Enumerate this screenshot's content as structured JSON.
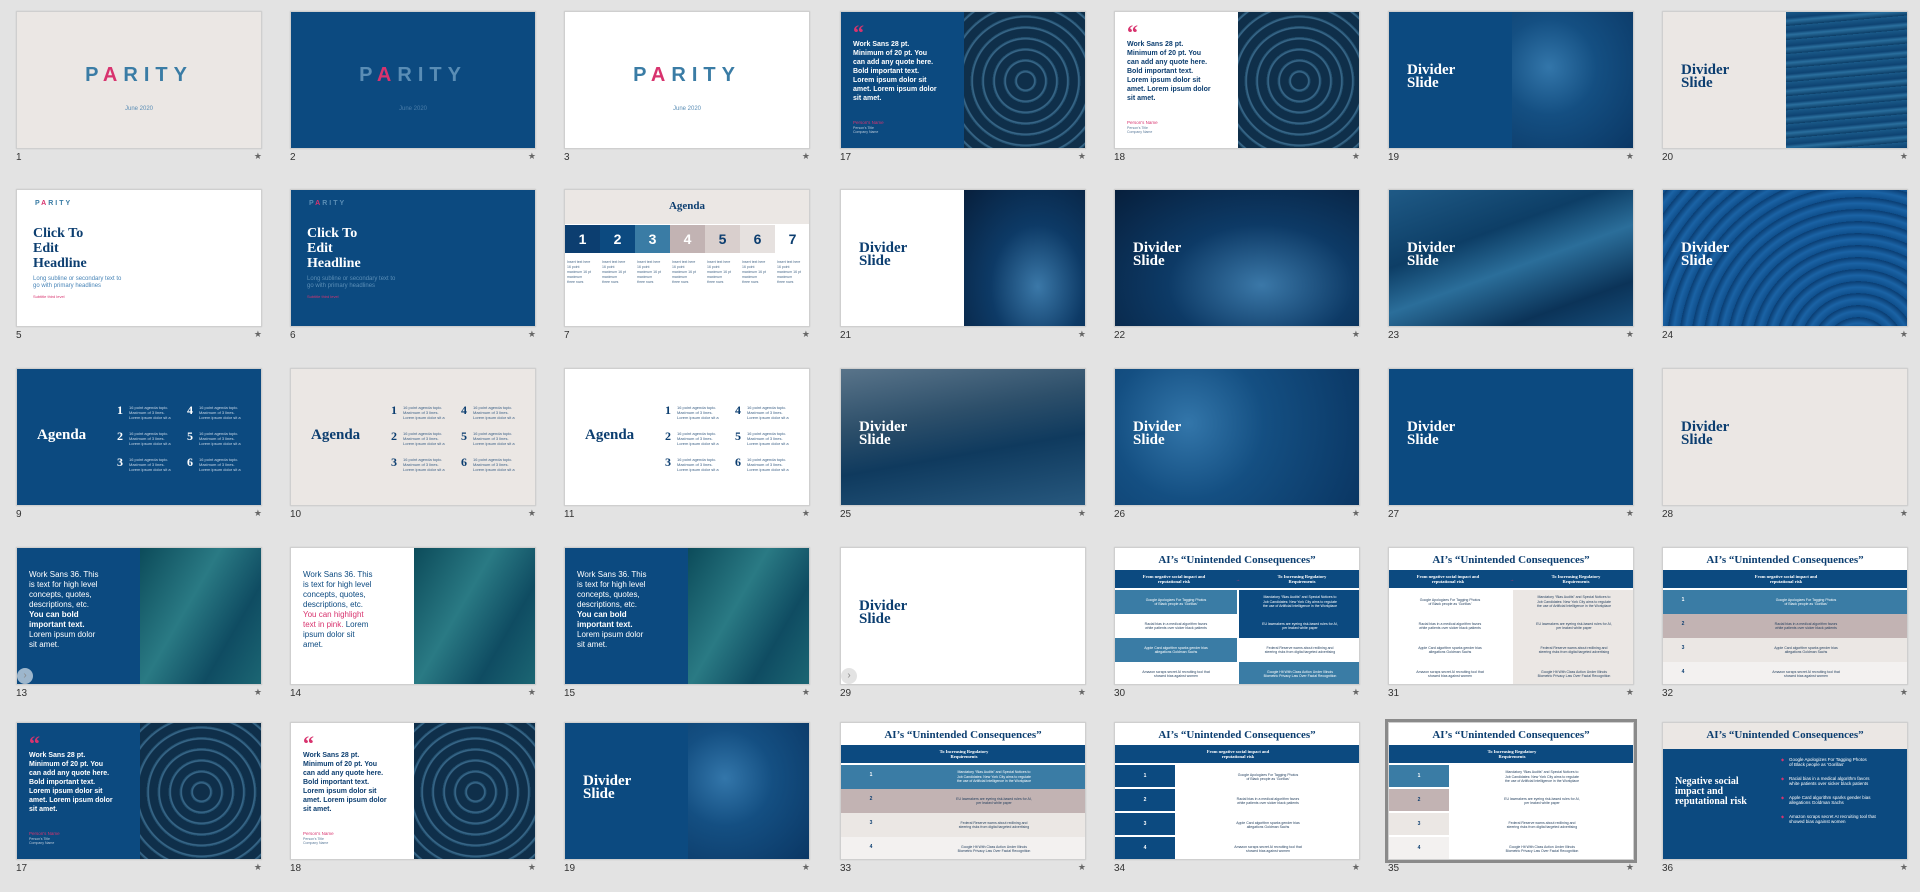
{
  "brand": {
    "logo_left": "P",
    "logo_a": "A",
    "logo_right": "RITY",
    "date": "June 2020",
    "colors": {
      "navy": "#0c4a80",
      "pink": "#d8336e",
      "teal": "#3a7ca5",
      "cream": "#ebe7e4"
    }
  },
  "headline": {
    "title": "Click To\nEdit\nHeadline",
    "subline": "Long subline or secondary text to\ngo with primary headlines",
    "tiny": "Subtitle third level"
  },
  "agenda": {
    "title": "Agenda",
    "numbers": [
      "1",
      "2",
      "3",
      "4",
      "5",
      "6"
    ],
    "item_text": "16 point agenda topic.\nMaximum of 3 lines.\nLorem ipsum dolor sit a",
    "steps": [
      "1",
      "2",
      "3",
      "4",
      "5",
      "6",
      "7"
    ],
    "step_text": "Insert text here\n16 point\nmaximum 16 pt\nmaximum\nthree rows"
  },
  "divider": {
    "text": "Divider\nSlide"
  },
  "quote": {
    "mark": "“",
    "text": "Work Sans 28 pt.\nMinimum of 20 pt. You\ncan add any quote here.\nBold important text.\nLorem ipsum dolor sit\namet. Lorem ipsum dolor\nsit amet.",
    "person": "Person's Name",
    "person_sub": "Person's Title\nCompany Name"
  },
  "body": {
    "line1": "Work Sans 36. This\nis text for high level\nconcepts, quotes,\ndescriptions, etc.",
    "bold": "You can bold\nimportant text.",
    "highlight": "You can highlight\ntext in pink.",
    "tail": "Lorem ipsum dolor\nsit amet.",
    "tail_inline": " Lorem\nipsum dolor sit\namet."
  },
  "ai": {
    "title": "AI’s “Unintended Consequences”",
    "col_left": "From negative social impact and\nreputational risk",
    "col_right": "To Increasing Regulatory\nRequirements",
    "arrow": "→",
    "left_rows": [
      "Google Apologizes For Tagging Photos\nof Black people as ‘Gorillas’",
      "Racial bias in a medical algorithm favors\nwhite patients over sicker black patients",
      "Apple Card algorithm sparks gender bias\nallegations Goldman Sachs",
      "Amazon scraps secret AI recruiting tool that\nshowed bias against women"
    ],
    "right_rows": [
      "Mandatory “Bias Audits” and Special Notices to\nJob Candidates: New York City aims to regulate\nthe use of Artificial Intelligence in the Workplace",
      "EU lawmakers are eyeing risk-based rules for AI,\nper leaked white paper",
      "Federal Reserve warns about redlining and\nsteering risks from digital targeted advertising",
      "Google Hit With Class Action Under Illinois\nBiometric Privacy Law Over Facial Recognition"
    ],
    "nums": [
      "1",
      "2",
      "3",
      "4"
    ],
    "s36_head": "Negative social\nimpact and\nreputational risk"
  },
  "nav": {
    "prev_arrow": "›"
  },
  "star": "★",
  "slide_numbers": {
    "r1": [
      "1",
      "2",
      "3",
      "17",
      "18",
      "19",
      "20"
    ],
    "r2": [
      "5",
      "6",
      "7",
      "21",
      "22",
      "23",
      "24"
    ],
    "r3": [
      "9",
      "10",
      "11",
      "25",
      "26",
      "27",
      "28"
    ],
    "r4": [
      "13",
      "14",
      "15",
      "29",
      "30",
      "31",
      "32"
    ],
    "r5": [
      "17",
      "18",
      "19",
      "33",
      "34",
      "35",
      "36"
    ]
  }
}
